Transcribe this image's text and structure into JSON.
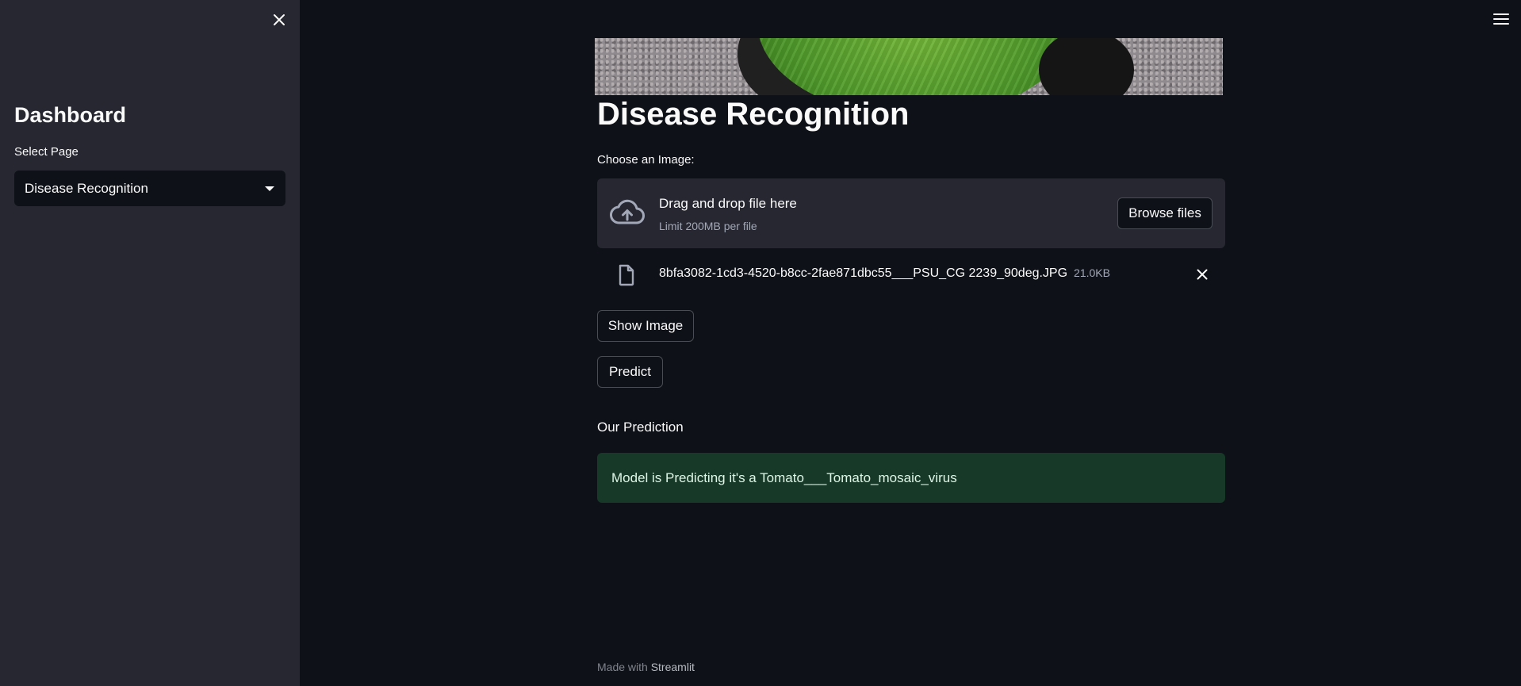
{
  "sidebar": {
    "close_icon": "close-icon",
    "title": "Dashboard",
    "select_label": "Select Page",
    "selected_page": "Disease Recognition"
  },
  "header": {
    "menu_icon": "hamburger-menu-icon"
  },
  "main": {
    "title": "Disease Recognition",
    "uploader": {
      "label": "Choose an Image:",
      "drop_text": "Drag and drop file here",
      "limit_text": "Limit 200MB per file",
      "browse_label": "Browse files",
      "icon": "cloud-upload-icon"
    },
    "uploaded_file": {
      "name": "8bfa3082-1cd3-4520-b8cc-2fae871dbc55___PSU_CG 2239_90deg.JPG",
      "size": "21.0KB",
      "icon": "file-icon"
    },
    "show_image_label": "Show Image",
    "predict_label": "Predict",
    "prediction_heading": "Our Prediction",
    "prediction_text": "Model is Predicting it's a Tomato___Tomato_mosaic_virus"
  },
  "footer": {
    "prefix": "Made with",
    "brand": "Streamlit"
  },
  "colors": {
    "background": "#0e1117",
    "sidebar": "#262730",
    "success_bg": "#173928"
  }
}
